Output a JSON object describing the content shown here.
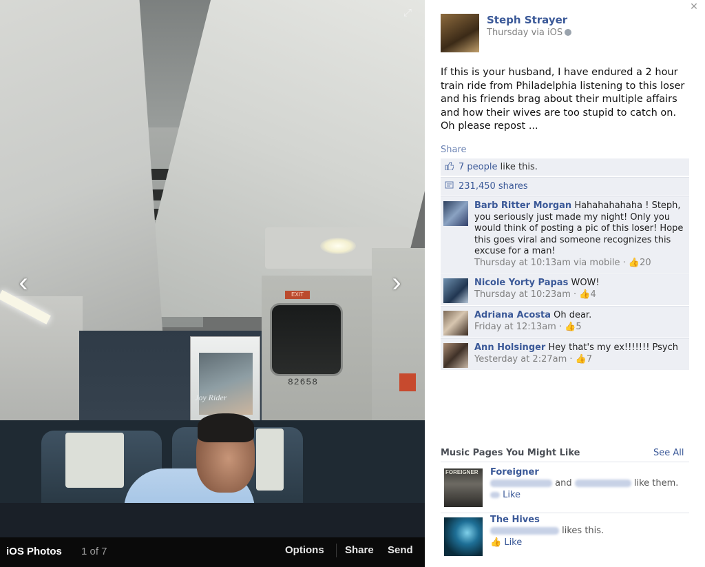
{
  "stage": {
    "poster_text": "Joy Rider",
    "door_number": "82658",
    "exit_label": "EXIT",
    "nav_prev_icon": "‹",
    "nav_next_icon": "›",
    "expand_icon": "⤢",
    "bar": {
      "album": "iOS Photos",
      "counter": "1 of 7",
      "options": "Options",
      "share": "Share",
      "send": "Send"
    }
  },
  "post": {
    "close_icon": "✕",
    "author": "Steph Strayer",
    "meta": "Thursday via iOS",
    "text": "If this is your husband, I have endured a 2 hour train ride from Philadelphia listening to this loser and his friends brag about their multiple affairs and how their wives are too stupid to catch on. Oh please repost ...",
    "share_link": "Share",
    "likes_link": "7 people",
    "likes_suffix": " like this.",
    "shares": "231,450 shares"
  },
  "comments": [
    {
      "name": "Barb Ritter Morgan",
      "text": " Hahahahahaha ! Steph, you seriously just made my night! Only you would think of posting a pic of this loser! Hope this goes viral and someone recognizes this excuse for a man!",
      "time": "Thursday at 10:13am via mobile · ",
      "likes": "20"
    },
    {
      "name": "Nicole Yorty Papas",
      "text": " WOW!",
      "time": "Thursday at 10:23am · ",
      "likes": "4"
    },
    {
      "name": "Adriana Acosta",
      "text": " Oh dear.",
      "time": "Friday at 12:13am · ",
      "likes": "5"
    },
    {
      "name": "Ann Holsinger",
      "text": " Hey that's my ex!!!!!!! Psych",
      "time": "Yesterday at 2:27am · ",
      "likes": "7"
    }
  ],
  "music": {
    "title": "Music Pages You Might Like",
    "see_all": "See All",
    "pages": [
      {
        "name": "Foreigner",
        "logo_text": "FOREIGNER",
        "mid": " and ",
        "suffix": " like them.",
        "like": "Like"
      },
      {
        "name": "The Hives",
        "suffix": " likes this.",
        "like": "Like"
      }
    ]
  },
  "colors": {
    "link": "#3b5998",
    "ufi_bg": "#edeff4",
    "stage_bg": "#0b0b0b"
  }
}
